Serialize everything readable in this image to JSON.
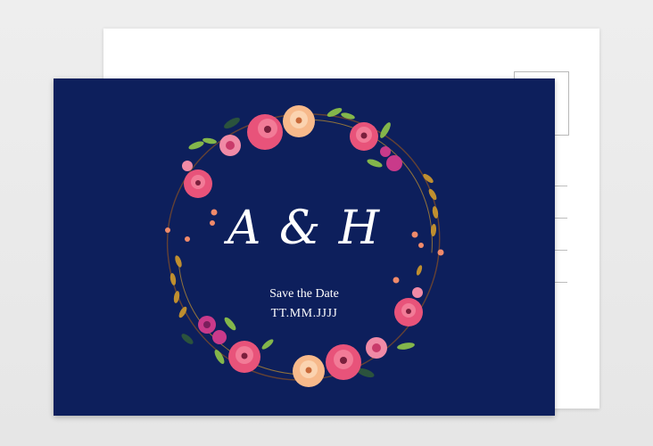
{
  "card": {
    "monogram": "A & H",
    "save_the_date": "Save the Date",
    "date_placeholder": "TT.MM.JJJJ"
  },
  "colors": {
    "background": "#e9e9e9",
    "card_front": "#0d1f5c",
    "text": "#ffffff",
    "flower_pink": "#e8537a",
    "flower_magenta": "#c93a8a",
    "flower_peach": "#f7b98b",
    "leaf_green": "#8bbf4a",
    "leaf_gold": "#c9952e"
  }
}
